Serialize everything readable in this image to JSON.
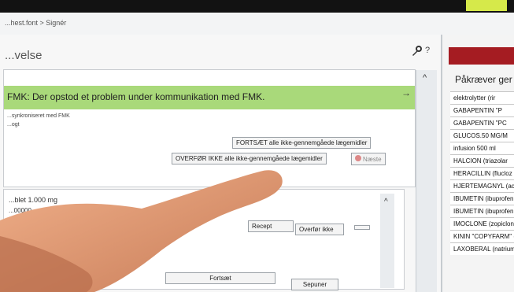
{
  "topbar": {
    "status_left": "",
    "status_mid": "",
    "status_right": ""
  },
  "breadcrumb": "...hest.font > Signér",
  "page_title": "...velse",
  "banner": {
    "message": "FMK: Der opstod et problem under kommunikation med FMK."
  },
  "panel": {
    "subline1": "...synkroniseret med FMK",
    "subline2": "...ogt"
  },
  "buttons": {
    "continue_all": "FORTSÆT alle ikke-gennemgåede lægemidler",
    "no_transfer_all": "OVERFØR IKKE alle ikke-gennemgåede lægemidler",
    "next": "Næste",
    "recept": "Recept",
    "transfer_not": "Overfør ikke",
    "continue": "Fortsæt",
    "pause": "Sepuner"
  },
  "lower": {
    "line1": "...blet 1.000 mg",
    "line2": "...00000"
  },
  "right_panel": {
    "heading": "Påkræver ger",
    "items": [
      "elektrolytter (rir",
      "GABAPENTIN \"P",
      "GABAPENTIN \"PC",
      "GLUCOS.50 MG/M",
      "infusion 500 ml",
      "HALCION (triazolar",
      "HERACILLIN (flucloz",
      "HJERTEMAGNYL (ac",
      "IBUMETIN (ibuprofen",
      "IBUMETIN (ibuprofen",
      "IMOCLONE (zopiclon)",
      "KININ \"COPYFARM\" (q",
      "LAXOBERAL (natriumpi"
    ]
  },
  "colors": {
    "accent_red": "#a51c22",
    "banner_green": "#a9d97a",
    "top_tile": "#d6e94a"
  },
  "icons": {
    "wrench": "wrench-icon",
    "help": "help-icon",
    "arrow": "arrow-right-icon",
    "chevron": "chevron-up-icon",
    "next": "next-icon",
    "document": "document-icon"
  }
}
